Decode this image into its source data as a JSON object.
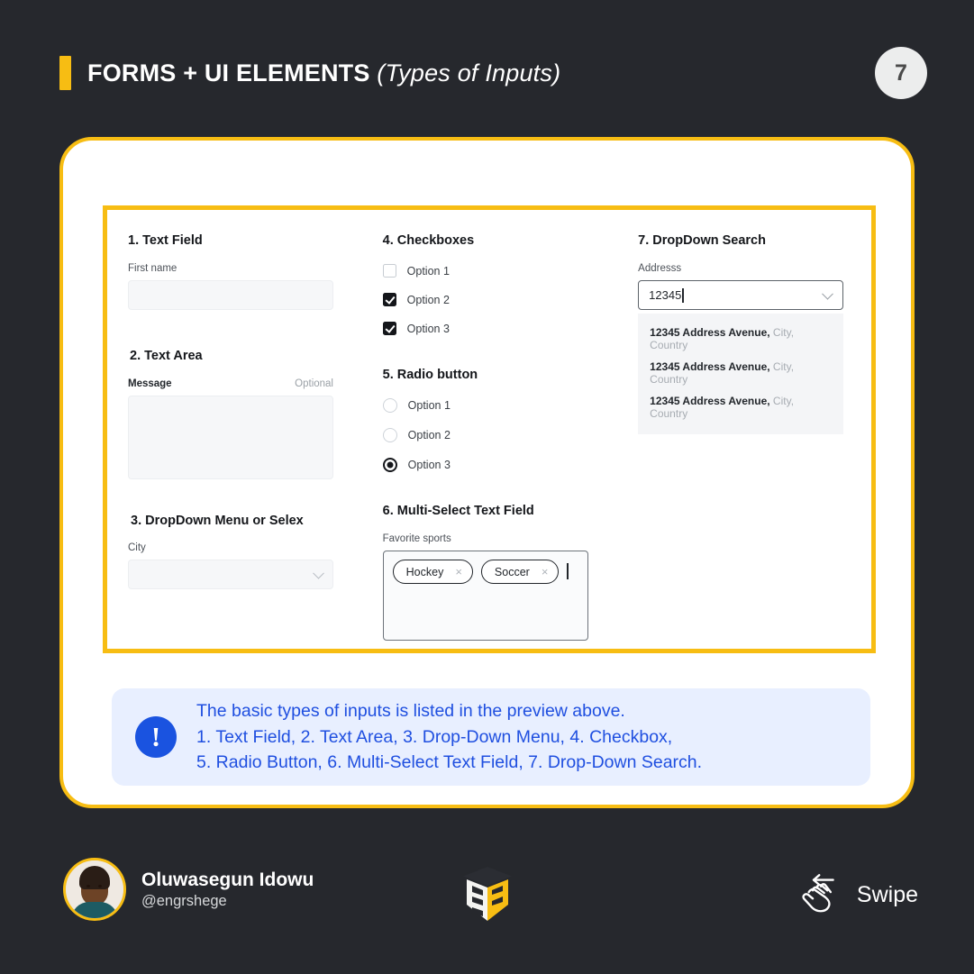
{
  "header": {
    "title_main": "FORMS + UI ELEMENTS",
    "title_sub": "(Types of Inputs)",
    "page_number": "7",
    "accent_color": "#f7bd13"
  },
  "preview": {
    "col1": {
      "s1_title": "1. Text Field",
      "s1_label": "First name",
      "s1_value": "",
      "s2_title": "2. Text Area",
      "s2_label": "Message",
      "s2_optional": "Optional",
      "s2_value": "",
      "s3_title": "3. DropDown Menu or Selex",
      "s3_label": "City",
      "s3_value": ""
    },
    "col2": {
      "s4_title": "4. Checkboxes",
      "checkboxes": [
        {
          "label": "Option 1",
          "checked": false
        },
        {
          "label": "Option 2",
          "checked": true
        },
        {
          "label": "Option 3",
          "checked": true
        }
      ],
      "s5_title": "5. Radio button",
      "radios": [
        {
          "label": "Option 1",
          "selected": false
        },
        {
          "label": "Option 2",
          "selected": false
        },
        {
          "label": "Option 3",
          "selected": true
        }
      ],
      "s6_title": "6. Multi-Select Text Field",
      "s6_label": "Favorite sports",
      "pills": [
        {
          "label": "Hockey",
          "remove": "×"
        },
        {
          "label": "Soccer",
          "remove": "×"
        }
      ]
    },
    "col3": {
      "s7_title": "7. DropDown Search",
      "s7_label": "Addresss",
      "s7_value": "12345",
      "suggestions": [
        {
          "main": "12345 Address Avenue,",
          "sub": "City, Country"
        },
        {
          "main": "12345 Address Avenue,",
          "sub": "City, Country"
        },
        {
          "main": "12345 Address Avenue,",
          "sub": "City, Country"
        }
      ]
    }
  },
  "callout": {
    "icon": "!",
    "line1": "The basic types of inputs is listed in the preview above.",
    "line2": "1. Text Field, 2. Text Area, 3. Drop-Down Menu, 4. Checkbox,",
    "line3": "5. Radio Button, 6. Multi-Select Text Field,  7. Drop-Down Search.",
    "text_color": "#1f4fe0",
    "bg_color": "#e8efff"
  },
  "footer": {
    "name": "Oluwasegun Idowu",
    "handle": "@engrshege",
    "swipe_label": "Swipe"
  }
}
